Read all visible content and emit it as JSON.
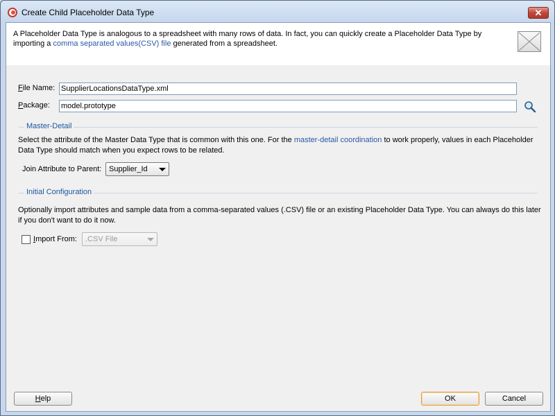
{
  "window": {
    "title": "Create Child Placeholder Data Type",
    "close_glyph": "✕"
  },
  "banner": {
    "text_part1": "A Placeholder Data Type is analogous to a spreadsheet with many rows of data. In fact, you can quickly create a Placeholder Data Type by importing a ",
    "link_text": "comma separated values(CSV) file",
    "text_part2": " generated from a spreadsheet.",
    "icon": "envelope-icon"
  },
  "form": {
    "file_name_label_mnemonic": "F",
    "file_name_label_rest": "ile Name:",
    "file_name_value": "SupplierLocationsDataType.xml",
    "package_label_mnemonic": "P",
    "package_label_rest": "ackage:",
    "package_value": "model.prototype",
    "package_browse_icon": "search-icon"
  },
  "master_detail": {
    "section_title": "Master-Detail",
    "text_part1": "Select the attribute of the Master Data Type that is common with this one. For the ",
    "link_text": "master-detail coordination",
    "text_part2": " to work properly, values in each Placeholder Data Type should match when you expect rows to be related.",
    "join_label": "Join Attribute to Parent:",
    "join_value": "Supplier_Id"
  },
  "initial_configuration": {
    "section_title": "Initial Configuration",
    "text": "Optionally import attributes and sample data from a comma-separated values (.CSV) file or an existing Placeholder Data Type. You can always do this later if you don't want to do it now.",
    "import_label_mnemonic": "I",
    "import_label_rest": "mport From:",
    "import_checked": false,
    "import_value": ".CSV File"
  },
  "buttons": {
    "help_mnemonic": "H",
    "help_rest": "elp",
    "ok": "OK",
    "cancel": "Cancel"
  }
}
